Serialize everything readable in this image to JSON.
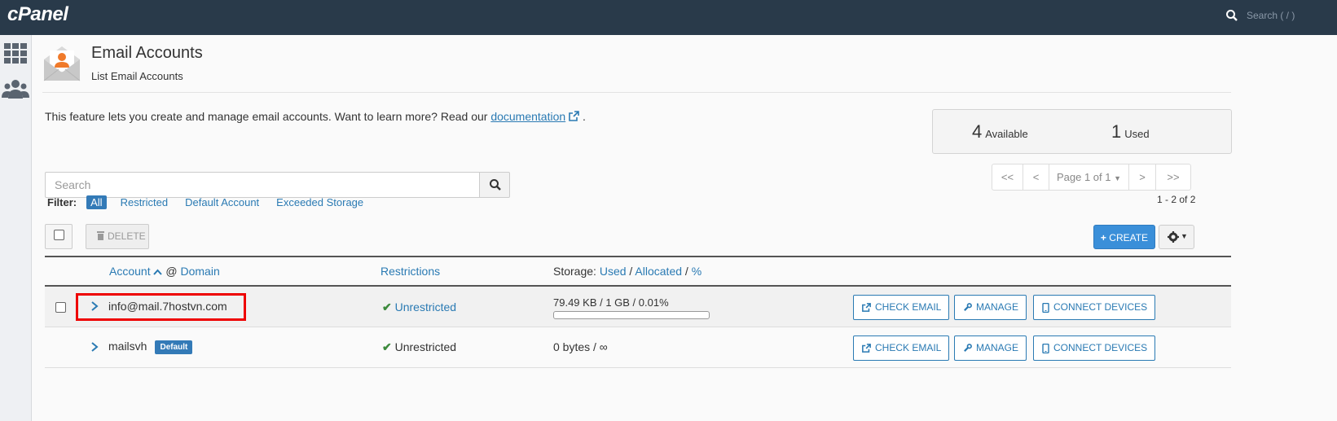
{
  "topbar": {
    "logo": "cPanel",
    "search_placeholder": "Search ( / )"
  },
  "page": {
    "title": "Email Accounts",
    "subtitle": "List Email Accounts"
  },
  "intro": {
    "text": "This feature lets you create and manage email accounts. Want to learn more? Read our ",
    "link": "documentation",
    "after": " ."
  },
  "stats": {
    "available_count": "4",
    "available_label": "Available",
    "used_count": "1",
    "used_label": "Used"
  },
  "search": {
    "placeholder": "Search"
  },
  "filter": {
    "label": "Filter:",
    "options": [
      "All",
      "Restricted",
      "Default Account",
      "Exceeded Storage"
    ]
  },
  "pager": {
    "first": "<<",
    "prev": "<",
    "page": "Page 1 of 1",
    "next": ">",
    "last": ">>",
    "range": "1 - 2 of 2"
  },
  "toolbar": {
    "delete": "DELETE",
    "create": "CREATE"
  },
  "table": {
    "col_account": "Account",
    "col_at": "@",
    "col_domain": "Domain",
    "col_restrictions": "Restrictions",
    "col_storage": "Storage:",
    "col_used": "Used",
    "col_allocated": "Allocated",
    "col_pct": "%",
    "rows": [
      {
        "account": "info@mail.7hostvn.com",
        "restriction": "Unrestricted",
        "storage": "79.49 KB / 1 GB / 0.01%",
        "usage_fraction": 0.0001
      },
      {
        "account": "mailsvh",
        "badge": "Default",
        "restriction": "Unrestricted",
        "storage": "0 bytes / ∞"
      }
    ],
    "actions": {
      "check": "CHECK EMAIL",
      "manage": "MANAGE",
      "connect": "CONNECT DEVICES"
    }
  },
  "colors": {
    "topbar": "#293a4a",
    "link": "#2a7ab3",
    "primary": "#3a8fd9",
    "highlight": "#ee0000",
    "check": "#3c8a3c"
  }
}
